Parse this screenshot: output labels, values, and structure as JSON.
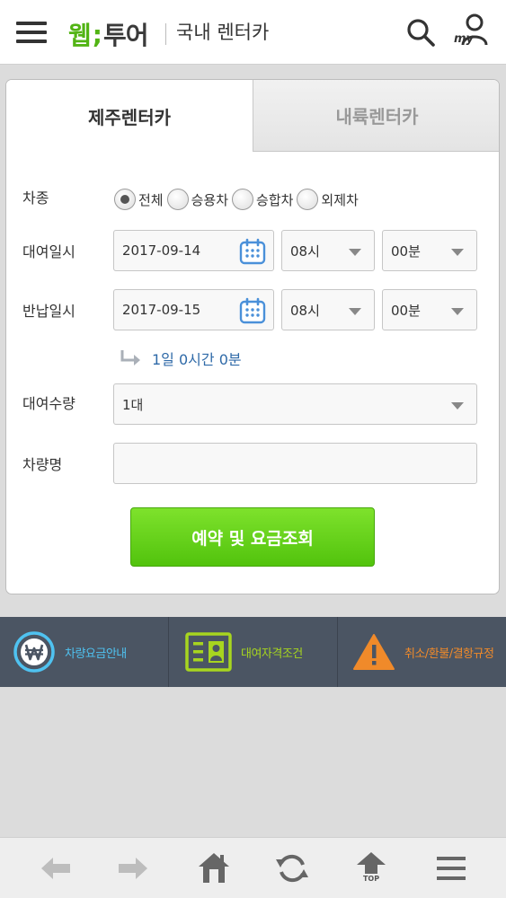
{
  "header": {
    "logo_part1": "웹",
    "logo_sep": ";",
    "logo_part2": "투어",
    "title": "국내 렌터카",
    "my_label": "my"
  },
  "tabs": [
    {
      "label": "제주렌터카",
      "active": true
    },
    {
      "label": "내륙렌터카",
      "active": false
    }
  ],
  "form": {
    "car_type": {
      "label": "차종",
      "options": [
        "전체",
        "승용차",
        "승합차",
        "외제차"
      ],
      "selected": "전체"
    },
    "pickup": {
      "label": "대여일시",
      "date": "2017-09-14",
      "hour": "08시",
      "minute": "00분"
    },
    "return": {
      "label": "반납일시",
      "date": "2017-09-15",
      "hour": "08시",
      "minute": "00분"
    },
    "duration": "1일 0시간 0분",
    "quantity": {
      "label": "대여수량",
      "value": "1대"
    },
    "car_name": {
      "label": "차량명",
      "value": ""
    },
    "submit_label": "예약 및 요금조회"
  },
  "info_links": [
    {
      "label": "차량요금안내",
      "icon": "won-icon"
    },
    {
      "label": "대여자격조건",
      "icon": "id-card-icon"
    },
    {
      "label": "취소/환불/결항규정",
      "icon": "warning-icon"
    }
  ],
  "bottom_nav": {
    "top_label": "TOP"
  },
  "colors": {
    "brand_green": "#52b414",
    "button_green": "#6ad61e",
    "info_bar_bg": "#4b5563",
    "duration_blue": "#2f6aa8"
  }
}
